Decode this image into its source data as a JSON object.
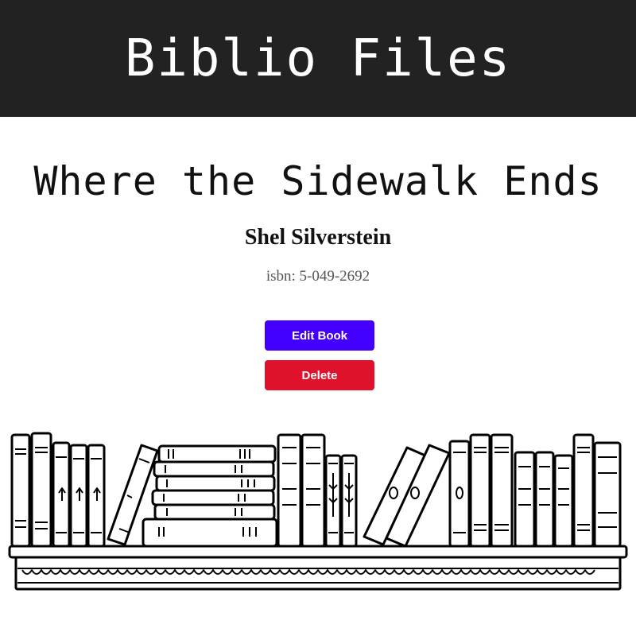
{
  "site": {
    "title": "Biblio Files"
  },
  "book": {
    "title": "Where the Sidewalk Ends",
    "author": "Shel Silverstein",
    "isbn_line": "isbn: 5-049-2692"
  },
  "actions": {
    "edit_label": "Edit Book",
    "delete_label": "Delete"
  },
  "colors": {
    "header_bg": "#222222",
    "edit_button": "#4400ff",
    "delete_button": "#e0112b"
  },
  "illustration": {
    "name": "bookshelf-illustration"
  }
}
